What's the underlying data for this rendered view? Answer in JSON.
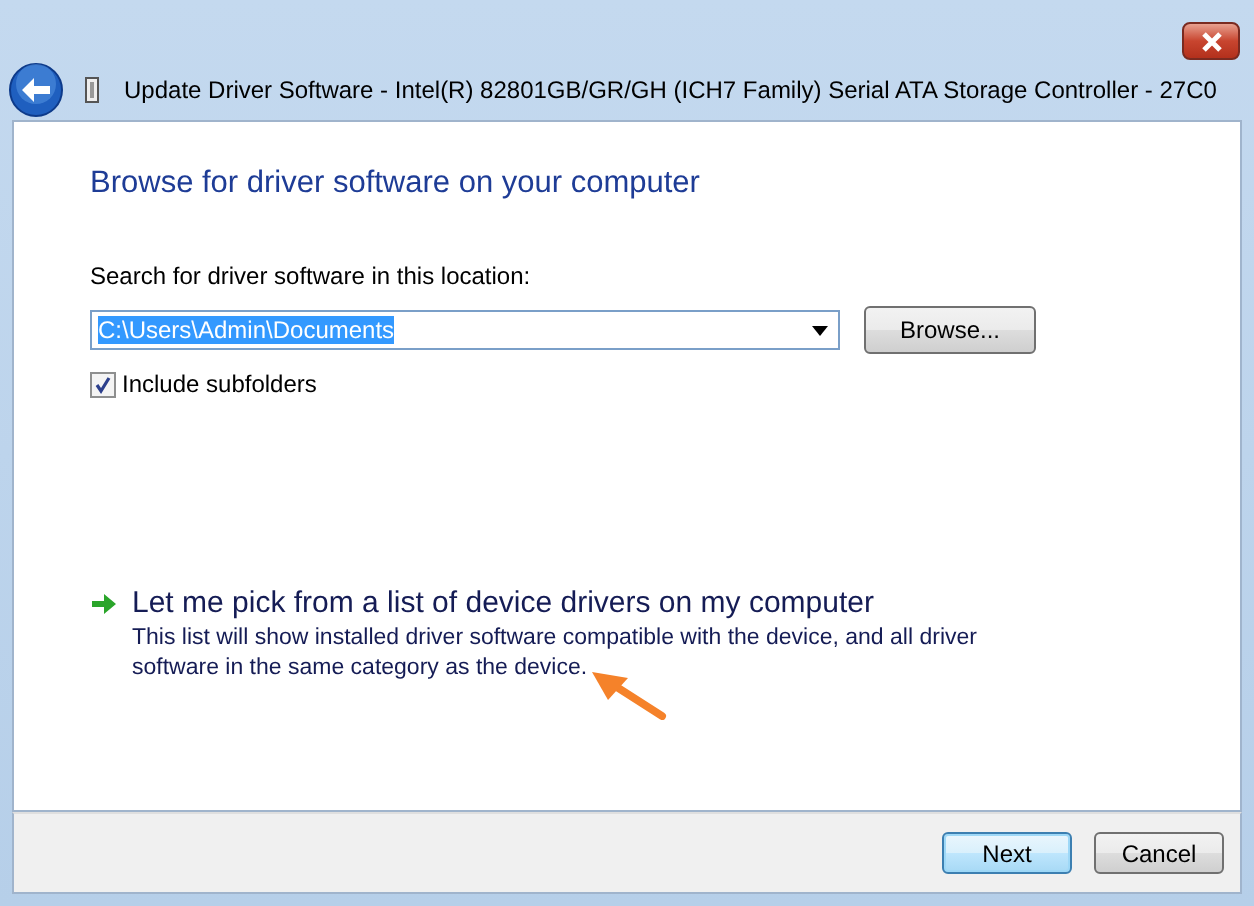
{
  "window": {
    "title": "Update Driver Software - Intel(R) 82801GB/GR/GH (ICH7 Family) Serial ATA Storage Controller - 27C0"
  },
  "heading": "Browse for driver software on your computer",
  "search": {
    "label": "Search for driver software in this location:",
    "value": "C:\\Users\\Admin\\Documents",
    "value_selected": true,
    "browse_button": "Browse..."
  },
  "include_subfolders": {
    "label": "Include subfolders",
    "checked": true
  },
  "option": {
    "title": "Let me pick from a list of device drivers on my computer",
    "description": "This list will show installed driver software compatible with the device, and all driver software in the same category as the device."
  },
  "buttons": [
    {
      "label": "Next",
      "default": true
    },
    {
      "label": "Cancel",
      "default": false
    }
  ]
}
